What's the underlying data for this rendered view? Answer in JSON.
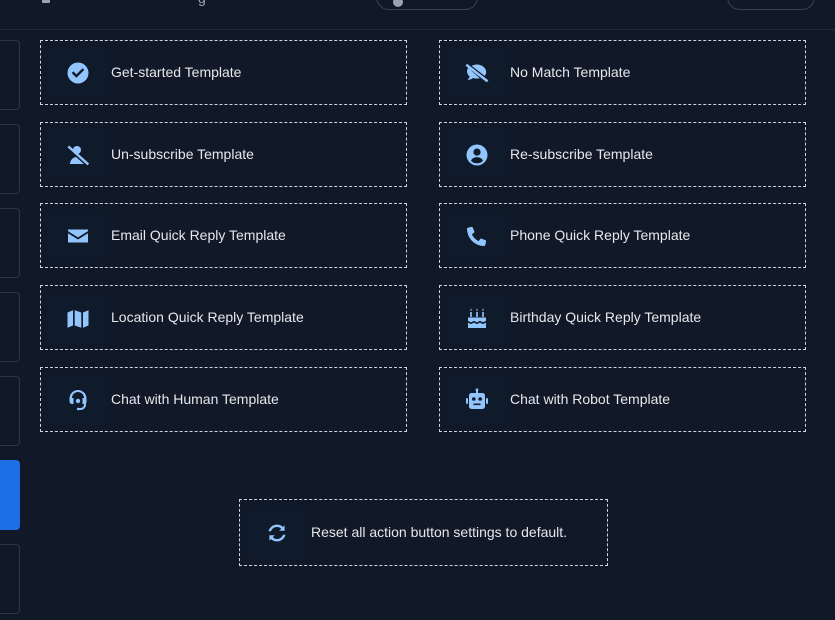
{
  "templates": [
    {
      "label": "Get-started Template",
      "icon": "check-circle-icon"
    },
    {
      "label": "No Match Template",
      "icon": "comment-slash-icon"
    },
    {
      "label": "Un-subscribe Template",
      "icon": "user-slash-icon"
    },
    {
      "label": "Re-subscribe Template",
      "icon": "user-circle-icon"
    },
    {
      "label": "Email Quick Reply Template",
      "icon": "envelope-icon"
    },
    {
      "label": "Phone Quick Reply Template",
      "icon": "phone-icon"
    },
    {
      "label": "Location Quick Reply Template",
      "icon": "map-icon"
    },
    {
      "label": "Birthday Quick Reply Template",
      "icon": "birthday-cake-icon"
    },
    {
      "label": "Chat with Human Template",
      "icon": "headset-icon"
    },
    {
      "label": "Chat with Robot Template",
      "icon": "robot-icon"
    }
  ],
  "reset": {
    "label": "Reset all action button settings to default.",
    "icon": "sync-icon"
  },
  "colors": {
    "background": "#111827",
    "icon": "#93c5fd",
    "sidebar_active": "#1e6fe6",
    "border": "#cbd5e1"
  }
}
